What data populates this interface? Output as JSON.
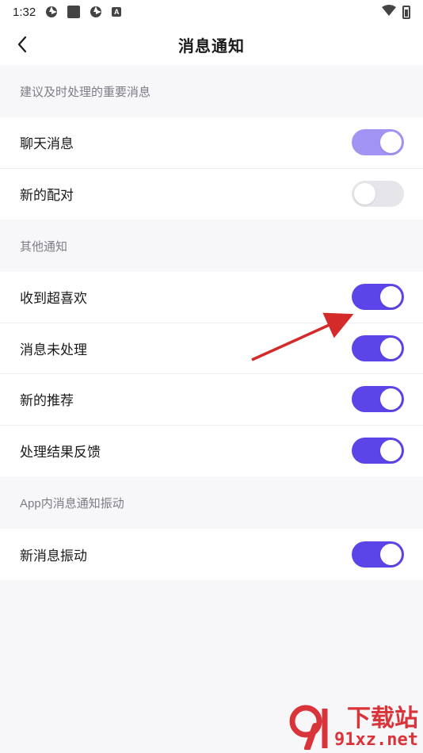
{
  "status_bar": {
    "time": "1:32",
    "badge_letter": "A"
  },
  "nav": {
    "title": "消息通知"
  },
  "sections": [
    {
      "header": "建议及时处理的重要消息",
      "items": [
        {
          "label": "聊天消息",
          "enabled": true,
          "color": "#a294f5"
        },
        {
          "label": "新的配对",
          "enabled": false,
          "color": "#e6e6ea"
        }
      ]
    },
    {
      "header": "其他通知",
      "items": [
        {
          "label": "收到超喜欢",
          "enabled": true,
          "color": "#5c45e8"
        },
        {
          "label": "消息未处理",
          "enabled": true,
          "color": "#5c45e8"
        },
        {
          "label": "新的推荐",
          "enabled": true,
          "color": "#5c45e8"
        },
        {
          "label": "处理结果反馈",
          "enabled": true,
          "color": "#5c45e8"
        }
      ]
    },
    {
      "header": "App内消息通知振动",
      "items": [
        {
          "label": "新消息振动",
          "enabled": true,
          "color": "#5c45e8"
        }
      ]
    }
  ],
  "colors": {
    "accent": "#5c45e8",
    "accent_dim": "#a294f5",
    "toggle_off": "#e6e6ea",
    "annotation_arrow": "#d42a2a",
    "watermark": "#d9343a"
  },
  "watermark": {
    "title": "下载站",
    "url": "91xz.net"
  }
}
